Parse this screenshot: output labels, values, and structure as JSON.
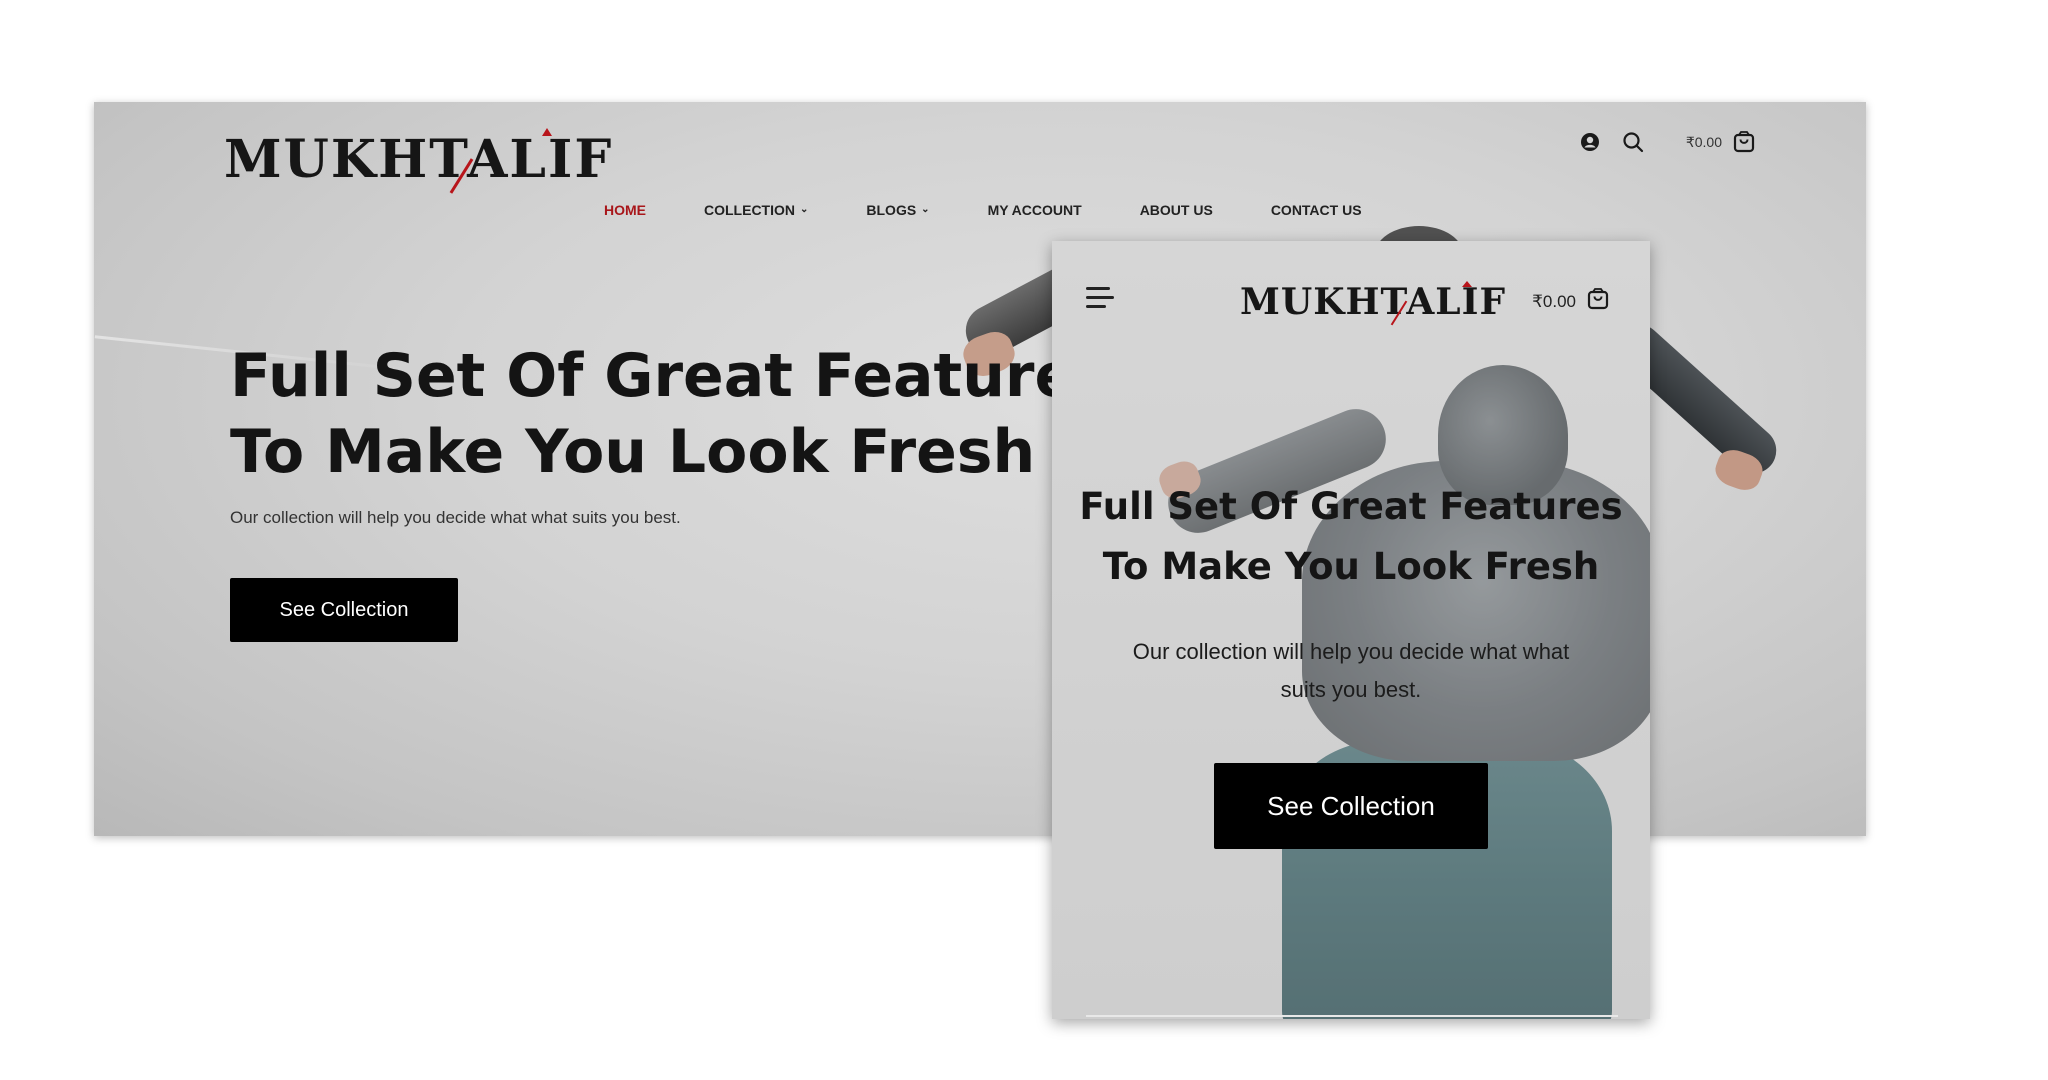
{
  "brand": {
    "logo_text": "MUKHTALIF",
    "accent_color": "#b8151b"
  },
  "desktop": {
    "nav": {
      "items": [
        {
          "label": "HOME",
          "active": true,
          "dropdown": false
        },
        {
          "label": "COLLECTION",
          "active": false,
          "dropdown": true
        },
        {
          "label": "BLOGS",
          "active": false,
          "dropdown": true
        },
        {
          "label": "MY ACCOUNT",
          "active": false,
          "dropdown": false
        },
        {
          "label": "ABOUT US",
          "active": false,
          "dropdown": false
        },
        {
          "label": "CONTACT US",
          "active": false,
          "dropdown": false
        }
      ]
    },
    "header_icons": [
      "account-icon",
      "search-icon",
      "cart-icon"
    ],
    "cart_total": "₹0.00",
    "hero": {
      "title_line1": "Full Set Of Great Features",
      "title_line2": "To Make You Look Fresh",
      "subtitle": "Our collection will help you decide what what suits you best.",
      "cta_label": "See Collection"
    }
  },
  "mobile": {
    "menu_icon": "hamburger-menu-icon",
    "cart_total": "₹0.00",
    "hero": {
      "title_line1": "Full Set Of Great Features",
      "title_line2": "To Make You Look Fresh",
      "subtitle": "Our collection will help you decide what what suits you best.",
      "cta_label": "See Collection"
    }
  },
  "colors": {
    "active_nav": "#a8161a",
    "button_bg": "#000000",
    "button_text": "#ffffff"
  }
}
